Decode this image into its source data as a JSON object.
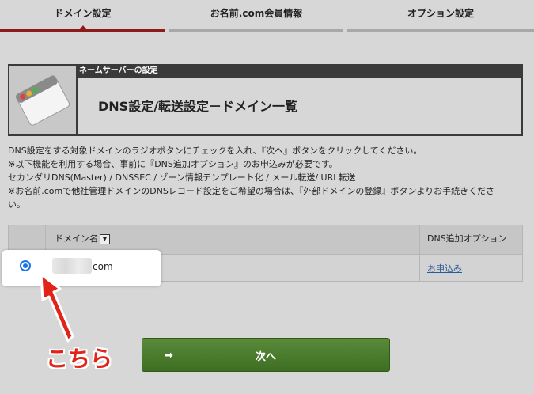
{
  "tabs": [
    {
      "label": "ドメイン設定",
      "active": true
    },
    {
      "label": "お名前.com会員情報",
      "active": false
    },
    {
      "label": "オプション設定",
      "active": false
    }
  ],
  "header": {
    "section_label": "ネームサーバーの設定",
    "title": "DNS設定/転送設定－ドメイン一覧"
  },
  "description": [
    "DNS設定をする対象ドメインのラジオボタンにチェックを入れ、『次へ』ボタンをクリックしてください。",
    "※以下機能を利用する場合、事前に『DNS追加オプション』のお申込みが必要です。",
    "セカンダリDNS(Master) / DNSSEC / ゾーン情報テンプレート化 / メール転送/ URL転送",
    "※お名前.comで他社管理ドメインのDNSレコード設定をご希望の場合は、『外部ドメインの登録』ボタンよりお手続きくださ",
    "い。"
  ],
  "table": {
    "headers": {
      "domain": "ドメイン名",
      "dns_option": "DNS追加オプション"
    },
    "rows": [
      {
        "domain_suffix": "com",
        "dns_option_link": "お申込み",
        "selected": true
      }
    ]
  },
  "next_button": {
    "label": "次へ",
    "arrow": "➡"
  },
  "annotation": {
    "text": "こちら",
    "color": "#e2231a"
  },
  "colors": {
    "accent_active_tab": "#8e1a1a",
    "next_button": "#4a7c2e",
    "radio": "#1a73e8",
    "link": "#2a5a9a"
  }
}
